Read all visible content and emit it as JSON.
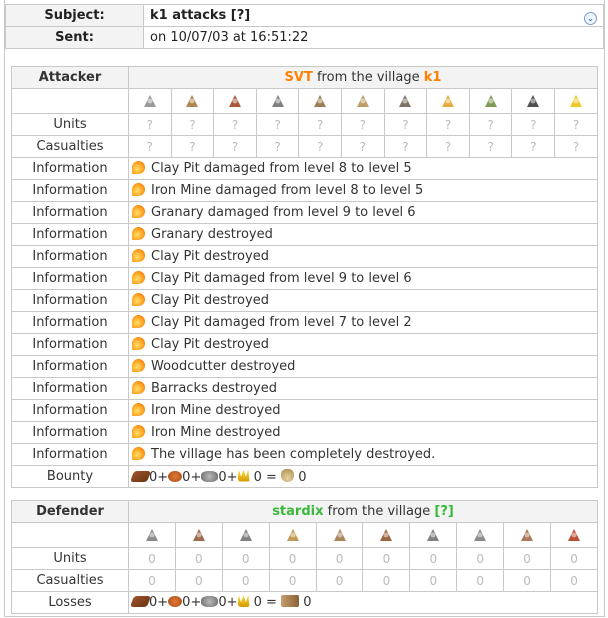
{
  "message": {
    "subject_label": "Subject:",
    "subject_value": "k1 attacks [?]",
    "sent_label": "Sent:",
    "sent_value": "on 10/07/03 at 16:51:22"
  },
  "attacker": {
    "role": "Attacker",
    "player": "SVT",
    "from_text": "from the village",
    "village": "k1",
    "units_label": "Units",
    "casualties_label": "Casualties",
    "units": [
      "?",
      "?",
      "?",
      "?",
      "?",
      "?",
      "?",
      "?",
      "?",
      "?",
      "?"
    ],
    "casualties": [
      "?",
      "?",
      "?",
      "?",
      "?",
      "?",
      "?",
      "?",
      "?",
      "?",
      "?"
    ],
    "unit_icons": [
      "club-icon",
      "spear-icon",
      "axe-icon",
      "scout-icon",
      "paladin-icon",
      "teuton-knight-icon",
      "ram-icon",
      "catapult-icon",
      "chief-icon",
      "settler-icon",
      "hero-icon"
    ],
    "info_label": "Information",
    "information": [
      "Clay Pit damaged from level 8 to level 5",
      "Iron Mine damaged from level 8 to level 5",
      "Granary damaged from level 9 to level 6",
      "Granary destroyed",
      "Clay Pit destroyed",
      "Clay Pit damaged from level 9 to level 6",
      "Clay Pit destroyed",
      "Clay Pit damaged from level 7 to level 2",
      "Clay Pit destroyed",
      "Woodcutter destroyed",
      "Barracks destroyed",
      "Iron Mine destroyed",
      "Iron Mine destroyed",
      "The village has been completely destroyed."
    ],
    "bounty_label": "Bounty",
    "bounty": {
      "wood": "0+",
      "clay": "0+",
      "iron": "0+",
      "crop": "0 =",
      "total": "0"
    }
  },
  "defender": {
    "role": "Defender",
    "player": "stardix",
    "from_text": "from the village",
    "village": "[?]",
    "units_label": "Units",
    "casualties_label": "Casualties",
    "units": [
      "0",
      "0",
      "0",
      "0",
      "0",
      "0",
      "0",
      "0",
      "0",
      "0"
    ],
    "casualties": [
      "0",
      "0",
      "0",
      "0",
      "0",
      "0",
      "0",
      "0",
      "0",
      "0"
    ],
    "unit_icons": [
      "legionnaire-icon",
      "praetorian-icon",
      "imperian-icon",
      "equites-legati-icon",
      "equites-imperatoris-icon",
      "equites-caesaris-icon",
      "battering-ram-icon",
      "fire-catapult-icon",
      "senator-icon",
      "settler-icon"
    ],
    "losses_label": "Losses",
    "losses": {
      "wood": "0+",
      "clay": "0+",
      "iron": "0+",
      "crop": "0 =",
      "total": "0"
    }
  },
  "colors": {
    "attacker": "#ff8000",
    "defender": "#39b93a",
    "border": "#c8c8c8",
    "header_bg": "#f3f3f3"
  }
}
